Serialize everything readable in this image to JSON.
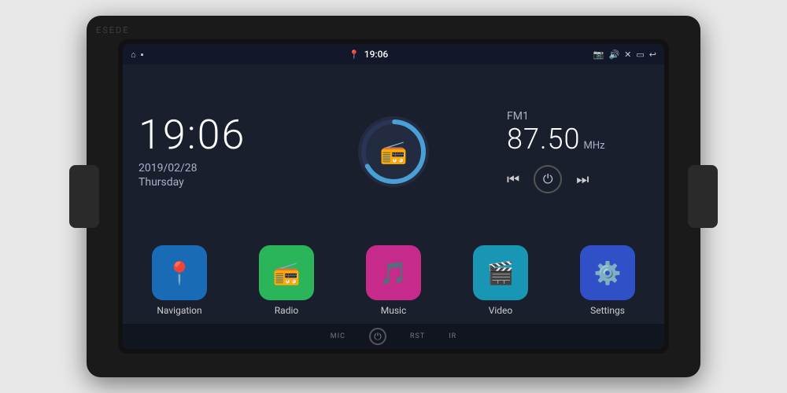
{
  "unit": {
    "watermark": "ESEDE"
  },
  "statusBar": {
    "location_icon": "📍",
    "time": "19:06",
    "camera_icon": "📷",
    "volume_icon": "🔊",
    "close_icon": "✕",
    "window_icon": "▭",
    "back_icon": "↩",
    "home_icon": "⌂",
    "menu_icon": "≡"
  },
  "clock": {
    "time": "19:06",
    "date": "2019/02/28",
    "day": "Thursday"
  },
  "radio": {
    "band": "FM1",
    "frequency": "87.50",
    "unit": "MHz"
  },
  "apps": [
    {
      "id": "navigation",
      "label": "Navigation",
      "bgClass": "bg-nav",
      "icon": "📍"
    },
    {
      "id": "radio",
      "label": "Radio",
      "bgClass": "bg-radio",
      "icon": "📻"
    },
    {
      "id": "music",
      "label": "Music",
      "bgClass": "bg-music",
      "icon": "🎵"
    },
    {
      "id": "video",
      "label": "Video",
      "bgClass": "bg-video",
      "icon": "🎬"
    },
    {
      "id": "settings",
      "label": "Settings",
      "bgClass": "bg-settings",
      "icon": "⚙️"
    }
  ],
  "bottomBar": {
    "mic_label": "MIC",
    "rst_label": "RST",
    "ir_label": "IR"
  }
}
